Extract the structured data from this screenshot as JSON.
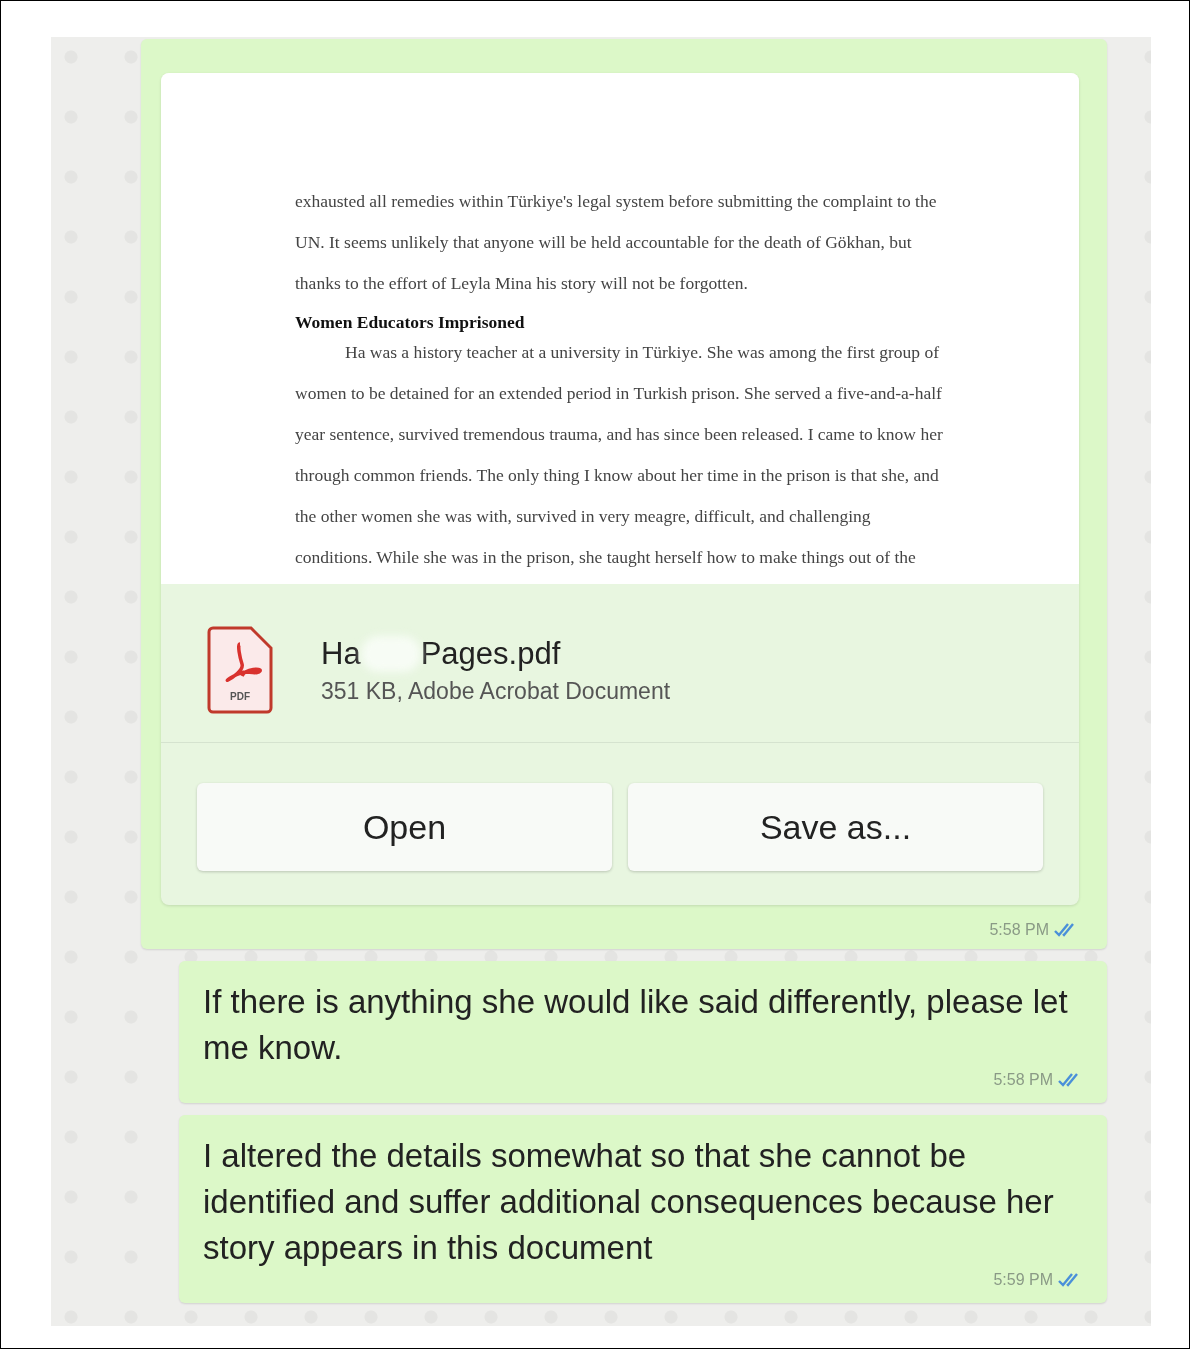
{
  "messages": [
    {
      "kind": "document",
      "time": "5:58 PM",
      "read": true,
      "preview": {
        "paragraphs": [
          {
            "kind": "body",
            "lines": [
              "exhausted all remedies within Türkiye's legal system before submitting the complaint to the",
              "UN. It seems unlikely that anyone will be held accountable for the death of Gökhan, but",
              "thanks to the effort of Leyla Mina his story will not be forgotten."
            ]
          },
          {
            "kind": "heading",
            "lines": [
              "Women Educators Imprisoned"
            ]
          },
          {
            "kind": "body",
            "indent": true,
            "lines": [
              "Ha was a history teacher at a university in Türkiye. She was among the first group of",
              "women to be detained for an extended period in Turkish prison. She served a five-and-a-half",
              "year sentence, survived tremendous trauma, and has since been released. I came to know her",
              "through common friends. The only thing I know about her time in the prison is that she, and",
              "the other women she was with, survived in very meagre, difficult, and challenging",
              "conditions. While she was in the prison, she taught herself how to make things out of the"
            ]
          }
        ]
      },
      "file": {
        "name_parts": [
          "Ha",
          "Pages.pdf"
        ],
        "details": "351 KB, Adobe Acrobat Document",
        "icon_label": "PDF"
      },
      "buttons": [
        "Open",
        "Save as..."
      ]
    },
    {
      "kind": "text",
      "time": "5:58 PM",
      "read": true,
      "text": "If there is anything she would like said differently, please let me know."
    },
    {
      "kind": "text",
      "time": "5:59 PM",
      "read": true,
      "text": "I altered the details somewhat so that she cannot be identified and suffer additional consequences because her story appears in this document"
    }
  ]
}
